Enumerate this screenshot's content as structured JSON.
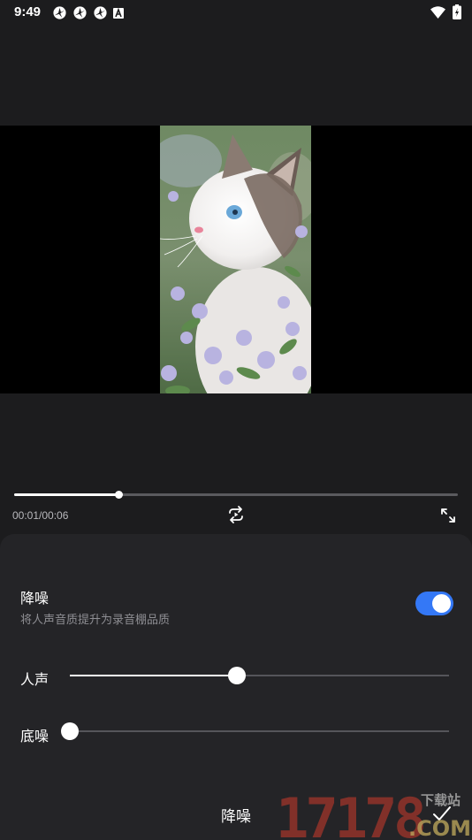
{
  "status_bar": {
    "time": "9:49",
    "icons": [
      "spinner-icon",
      "spinner-icon",
      "spinner-icon",
      "a-badge-icon",
      "wifi-icon",
      "battery-charging-icon"
    ]
  },
  "player": {
    "time": "00:01/00:06",
    "progress": 0.235
  },
  "denoise": {
    "title": "降噪",
    "description": "将人声音质提升为录音棚品质",
    "enabled": true,
    "accent_color": "#3478f6"
  },
  "sliders": [
    {
      "label": "人声",
      "value": 0.44
    },
    {
      "label": "底噪",
      "value": 0.0
    }
  ],
  "bottom_bar": {
    "title": "降噪"
  },
  "watermark": {
    "text": "17178",
    "sub": "下载站",
    "suffix": ".COM"
  }
}
